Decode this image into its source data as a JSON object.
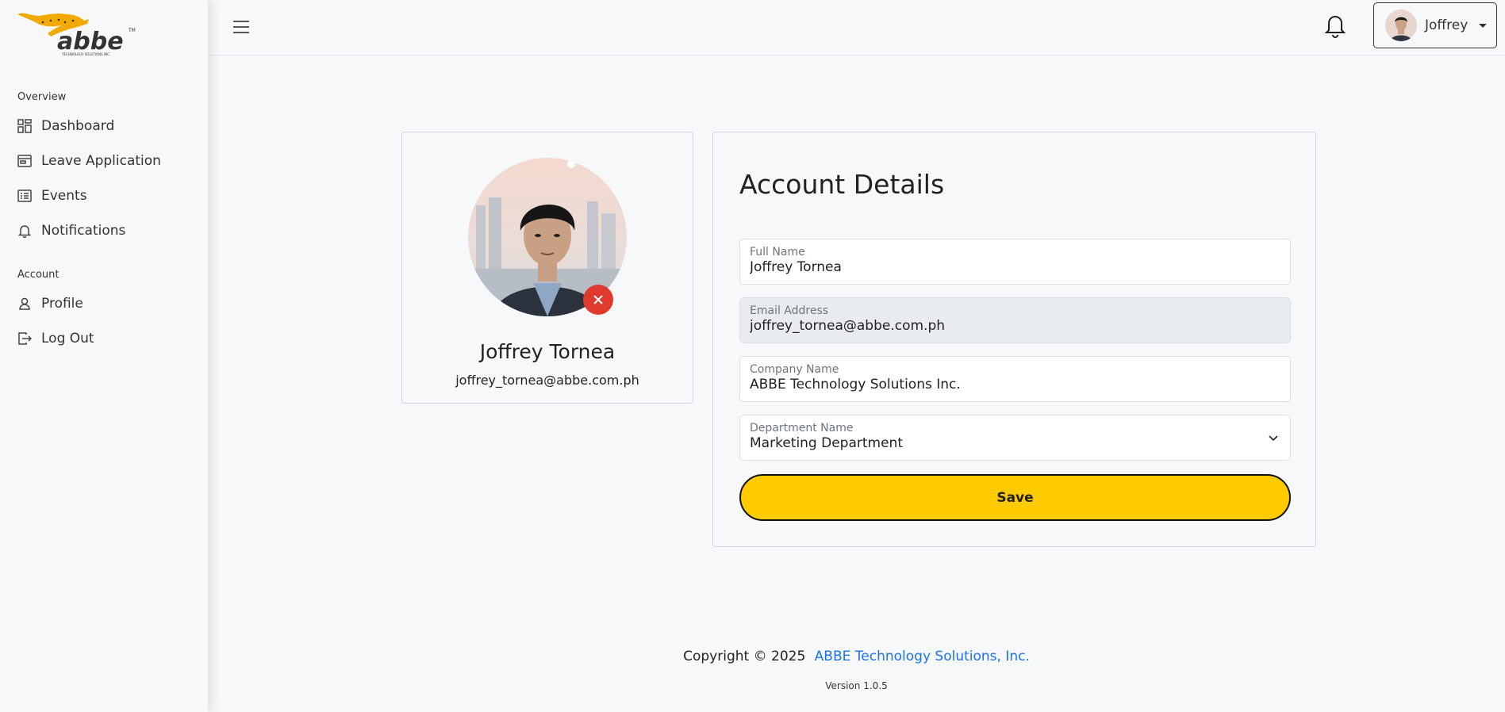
{
  "brand": {
    "logo_text": "abbe",
    "logo_tm": "TM",
    "logo_sub": "TECHNOLOGY SOLUTIONS INC.",
    "accent": "#fecb00",
    "danger": "#e03a2f",
    "link": "#1a73e8"
  },
  "sidebar": {
    "overview_label": "Overview",
    "account_label": "Account",
    "items": [
      {
        "label": "Dashboard",
        "icon": "dashboard-icon"
      },
      {
        "label": "Leave Application",
        "icon": "wallet-icon"
      },
      {
        "label": "Events",
        "icon": "list-card-icon"
      },
      {
        "label": "Notifications",
        "icon": "bell-icon"
      },
      {
        "label": "Profile",
        "icon": "user-icon"
      },
      {
        "label": "Log Out",
        "icon": "logout-icon"
      }
    ]
  },
  "header": {
    "user_name": "Joffrey"
  },
  "profile": {
    "name": "Joffrey Tornea",
    "email": "joffrey_tornea@abbe.com.ph"
  },
  "account": {
    "title": "Account Details",
    "full_name_label": "Full Name",
    "full_name_value": "Joffrey Tornea",
    "email_label": "Email Address",
    "email_value": "joffrey_tornea@abbe.com.ph",
    "company_label": "Company Name",
    "company_value": "ABBE Technology Solutions Inc.",
    "department_label": "Department Name",
    "department_value": "Marketing Department",
    "save_label": "Save"
  },
  "footer": {
    "copyright": "Copyright © 2025",
    "company_link": "ABBE Technology Solutions, Inc.",
    "version": "Version 1.0.5"
  }
}
